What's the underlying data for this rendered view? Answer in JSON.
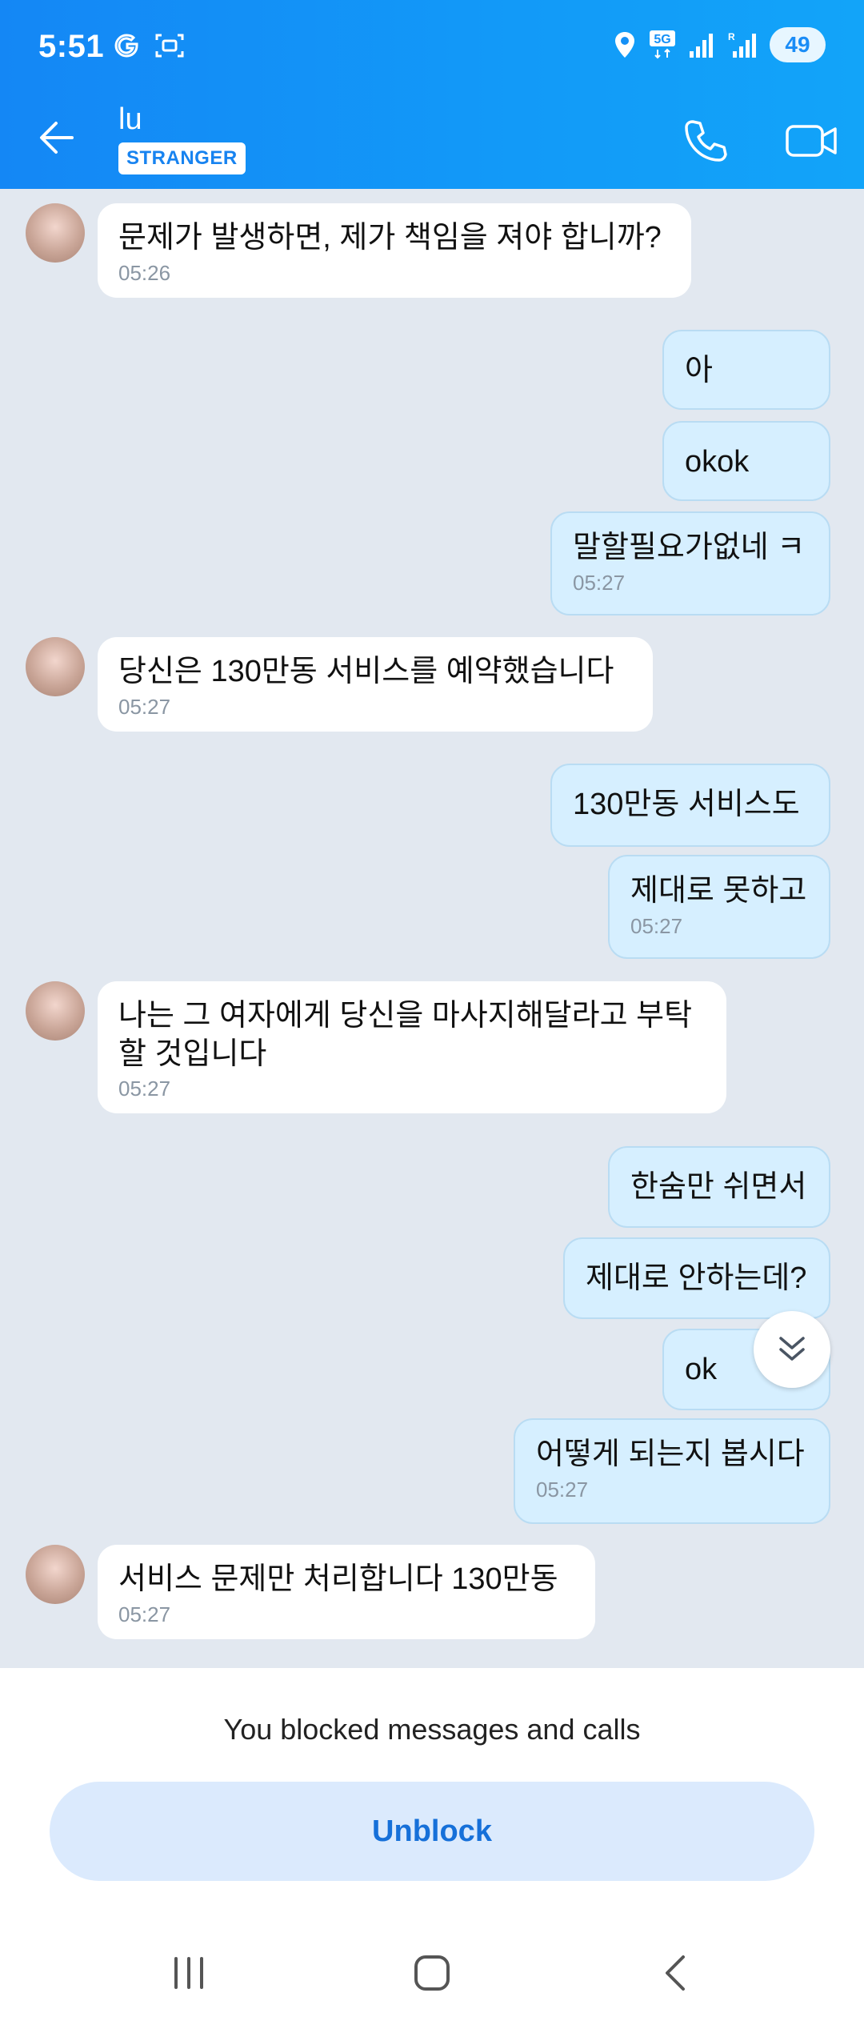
{
  "status_bar": {
    "time": "5:51",
    "battery": "49",
    "icons": [
      "google-icon",
      "screenshot-icon",
      "location-icon",
      "5g-icon",
      "signal-icon",
      "signal-r-icon",
      "battery-icon"
    ]
  },
  "app_bar": {
    "contact_name": "lu",
    "badge": "STRANGER",
    "icons": [
      "back-arrow-icon",
      "phone-icon",
      "video-camera-icon"
    ]
  },
  "messages": [
    {
      "dir": "in",
      "text": "문제가 발생하면, 제가 책임을 져야 합니까?",
      "time": "05:26"
    },
    {
      "dir": "out",
      "text": "아",
      "time": ""
    },
    {
      "dir": "out",
      "text": "okok",
      "time": ""
    },
    {
      "dir": "out",
      "text": "말할필요가없네 ㅋ",
      "time": "05:27"
    },
    {
      "dir": "in",
      "text": "당신은 130만동 서비스를 예약했습니다",
      "time": "05:27"
    },
    {
      "dir": "out",
      "text": "130만동 서비스도",
      "time": ""
    },
    {
      "dir": "out",
      "text": "제대로 못하고",
      "time": "05:27"
    },
    {
      "dir": "in",
      "text": "나는 그 여자에게 당신을 마사지해달라고 부탁 할 것입니다",
      "time": "05:27"
    },
    {
      "dir": "out",
      "text": "한숨만 쉬면서",
      "time": ""
    },
    {
      "dir": "out",
      "text": "제대로 안하는데?",
      "time": ""
    },
    {
      "dir": "out",
      "text": "ok",
      "time": ""
    },
    {
      "dir": "out",
      "text": "어떻게 되는지 봅시다",
      "time": "05:27"
    },
    {
      "dir": "in",
      "text": "서비스 문제만 처리합니다 130만동",
      "time": "05:27"
    }
  ],
  "blocked": {
    "notice": "You blocked messages and calls",
    "unblock_label": "Unblock"
  },
  "nav_bar": {
    "icons": [
      "recent-apps-icon",
      "home-icon",
      "back-icon"
    ]
  },
  "colors": {
    "header_gradient_start": "#1487f5",
    "header_gradient_end": "#12a4f9",
    "chat_background": "#e2e8f0",
    "incoming_bubble": "#ffffff",
    "outgoing_bubble": "#d6efff",
    "unblock_button_bg": "#dbeafd",
    "unblock_button_text": "#1670d9"
  }
}
